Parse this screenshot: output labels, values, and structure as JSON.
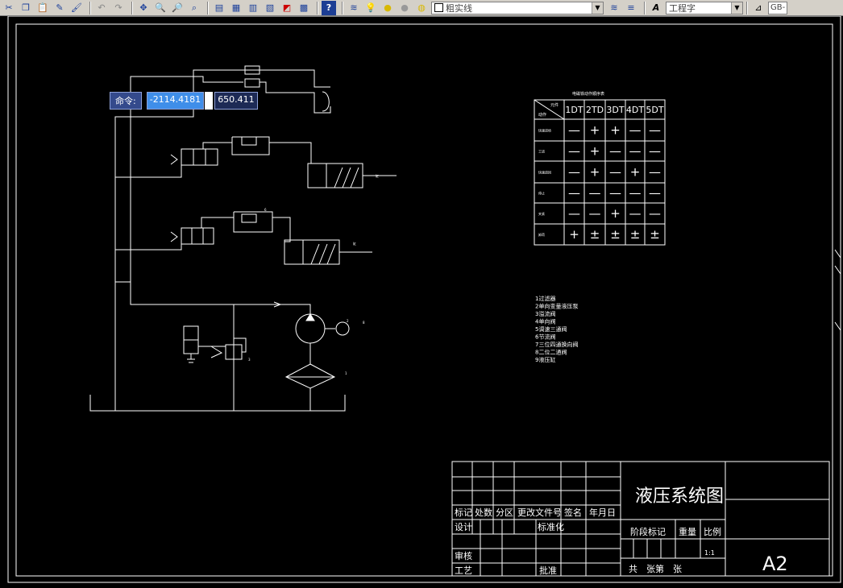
{
  "toolbar": {
    "line_style": "粗实线",
    "text_style": "工程字",
    "standard": "GB-"
  },
  "command_tooltip": {
    "label": "命令:",
    "x_value": "-2114.4181",
    "y_value": "650.411"
  },
  "state_table": {
    "title": "电磁铁动作顺序表",
    "corner_top": "元件",
    "corner_bottom": "动作",
    "columns": [
      "1DT",
      "2TD",
      "3DT",
      "4DT",
      "5DT"
    ],
    "rows": [
      {
        "label": "快速进给",
        "cells": [
          "—",
          "+",
          "+",
          "—",
          "—"
        ]
      },
      {
        "label": "工进",
        "cells": [
          "—",
          "+",
          "—",
          "—",
          "—"
        ]
      },
      {
        "label": "快速退回",
        "cells": [
          "—",
          "+",
          "—",
          "+",
          "—"
        ]
      },
      {
        "label": "停止",
        "cells": [
          "—",
          "—",
          "—",
          "—",
          "—"
        ]
      },
      {
        "label": "夹紧",
        "cells": [
          "—",
          "—",
          "+",
          "—",
          "—"
        ]
      },
      {
        "label": "卸荷",
        "cells": [
          "+",
          "±",
          "±",
          "±",
          "±"
        ]
      }
    ]
  },
  "component_list": [
    "1过滤器",
    "2单向变量液压泵",
    "3溢流阀",
    "4单向阀",
    "5调速三通阀",
    "6节流阀",
    "7三位四通换向阀",
    "8二位二通阀",
    "9液压缸"
  ],
  "title_block": {
    "drawing_title": "液压系统图",
    "headers": [
      "标记",
      "处数",
      "分区",
      "更改文件号",
      "签名",
      "年月日"
    ],
    "design": "设计",
    "standardization": "标准化",
    "review": "审核",
    "process": "工艺",
    "approve": "批准",
    "stage_mark": "阶段标记",
    "weight": "重量",
    "scale": "比例",
    "scale_value": "1:1",
    "sheets": "共　张第　张",
    "paper_size": "A2"
  },
  "diagram_labels": {
    "pump_no": "2",
    "filter_no": "1",
    "motor_no": "8",
    "valve_no": "3",
    "throttle_no": "6",
    "cyl_label": "缸"
  }
}
